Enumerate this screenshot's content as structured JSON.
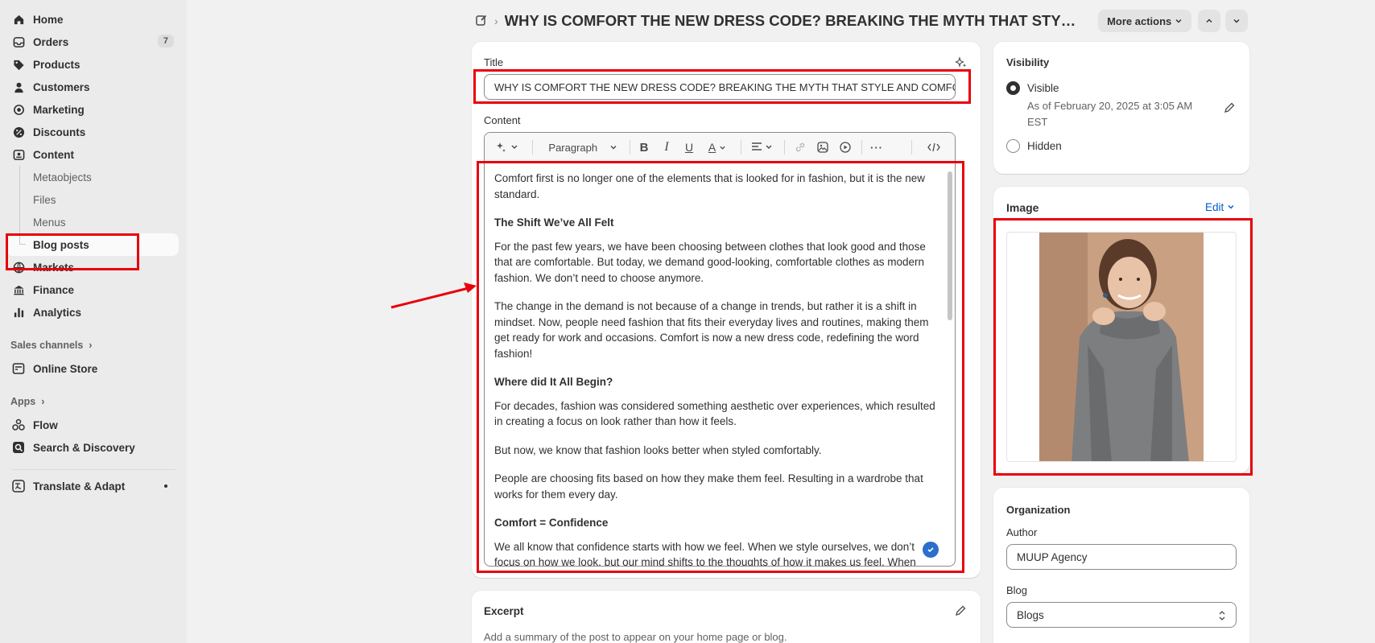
{
  "sidebar": {
    "items": [
      {
        "label": "Home",
        "icon": "home-icon"
      },
      {
        "label": "Orders",
        "icon": "orders-icon",
        "count": "7"
      },
      {
        "label": "Products",
        "icon": "tag-icon"
      },
      {
        "label": "Customers",
        "icon": "person-icon"
      },
      {
        "label": "Marketing",
        "icon": "target-icon"
      },
      {
        "label": "Discounts",
        "icon": "discount-icon"
      },
      {
        "label": "Content",
        "icon": "content-icon"
      }
    ],
    "content_sub": [
      "Metaobjects",
      "Files",
      "Menus",
      "Blog posts"
    ],
    "items2": [
      {
        "label": "Markets",
        "icon": "globe-icon"
      },
      {
        "label": "Finance",
        "icon": "bank-icon"
      },
      {
        "label": "Analytics",
        "icon": "bar-chart-icon"
      }
    ],
    "sales_channels_label": "Sales channels",
    "online_store": "Online Store",
    "apps_label": "Apps",
    "apps": [
      "Flow",
      "Search & Discovery"
    ],
    "translate": "Translate & Adapt"
  },
  "header": {
    "title": "WHY IS COMFORT THE NEW DRESS CODE? BREAKING THE MYTH THAT STYLE A...",
    "more_actions": "More actions"
  },
  "editor": {
    "title_label": "Title",
    "title_value": "WHY IS COMFORT THE NEW DRESS CODE? BREAKING THE MYTH THAT STYLE AND COMFO",
    "content_label": "Content",
    "paragraph_select": "Paragraph",
    "blocks": [
      {
        "type": "p",
        "text": "Comfort first is no longer one of the elements that is looked for in fashion, but it is the new standard."
      },
      {
        "type": "h",
        "text": "The Shift We’ve All Felt"
      },
      {
        "type": "p",
        "text": "For the past few years, we have been choosing between clothes that look good and those that are comfortable. But today, we demand good-looking, comfortable clothes as modern fashion. We don’t need to choose anymore."
      },
      {
        "type": "p",
        "text": "The change in the demand is not because of a change in trends, but rather it is a shift in mindset. Now, people need fashion that fits their everyday lives and routines, making them get ready for work and occasions. Comfort is now a new dress code, redefining the word fashion!"
      },
      {
        "type": "h",
        "text": "Where did It All Begin?"
      },
      {
        "type": "p",
        "text": "For decades, fashion was considered something aesthetic over experiences, which resulted in creating a focus on look rather than how it feels."
      },
      {
        "type": "p",
        "text": "But now, we know that fashion looks better when styled comfortably."
      },
      {
        "type": "p",
        "text": "People are choosing fits based on how they make them feel. Resulting in a wardrobe that works for them every day."
      },
      {
        "type": "h",
        "text": "Comfort = Confidence"
      },
      {
        "type": "p",
        "text": "We all know that confidence starts with how we feel. When we style ourselves, we don’t focus on how we look, but our mind shifts to the thoughts of how it makes us feel. When"
      }
    ]
  },
  "excerpt": {
    "title": "Excerpt",
    "hint": "Add a summary of the post to appear on your home page or blog."
  },
  "visibility": {
    "title": "Visibility",
    "visible": "Visible",
    "meta": "As of February 20, 2025 at 3:05 AM EST",
    "hidden": "Hidden"
  },
  "image": {
    "title": "Image",
    "edit": "Edit"
  },
  "organization": {
    "title": "Organization",
    "author_label": "Author",
    "author_value": "MUUP Agency",
    "blog_label": "Blog",
    "blog_value": "Blogs"
  },
  "colors": {
    "annotation_red": "#e8000b",
    "link_blue": "#005bd3"
  }
}
